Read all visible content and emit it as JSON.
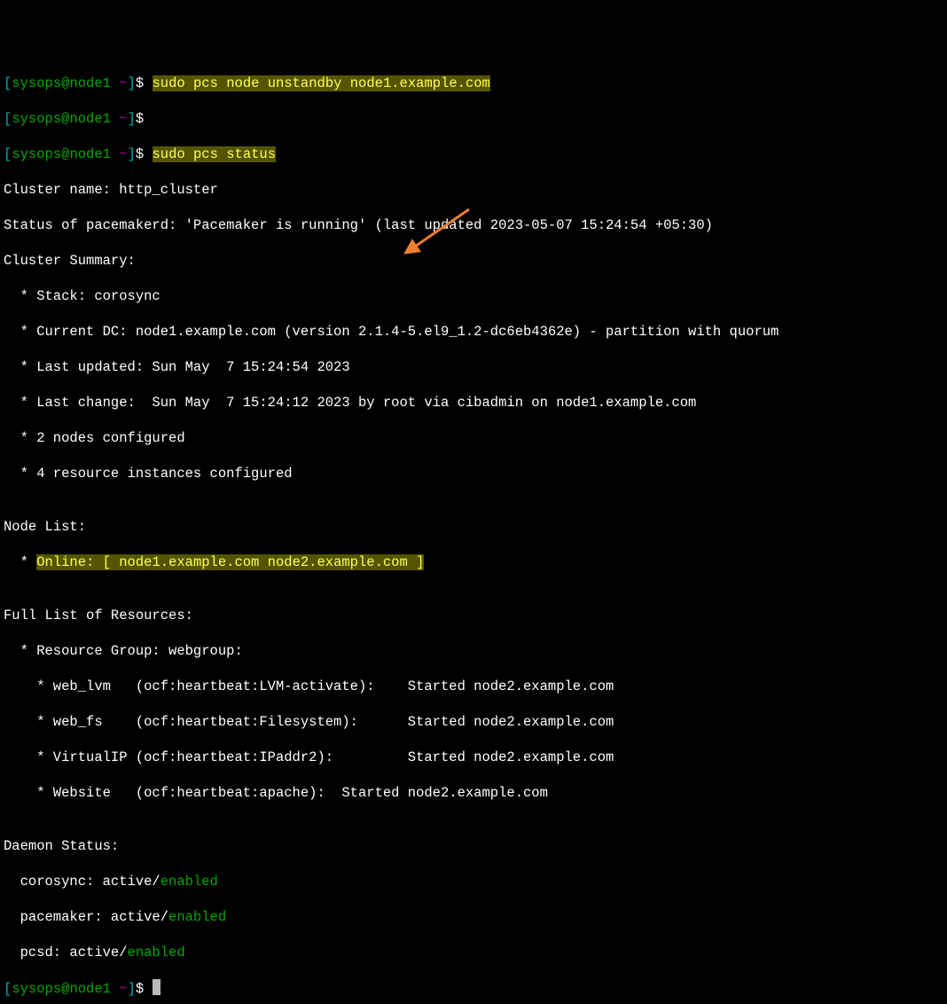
{
  "prompt": {
    "open": "[",
    "user": "sysops",
    "at": "@",
    "host": "node1",
    "space": " ",
    "tilde": "~",
    "close": "]",
    "dollar": "$ "
  },
  "commands": {
    "cmd1": "sudo pcs node unstandby node1.example.com",
    "cmd2": "sudo pcs status"
  },
  "output": {
    "clusterName": "Cluster name: http_cluster",
    "pacemakerd": "Status of pacemakerd: 'Pacemaker is running' (last updated 2023-05-07 15:24:54 +05:30)",
    "summaryHdr": "Cluster Summary:",
    "stack": "  * Stack: corosync",
    "currentDC": "  * Current DC: node1.example.com (version 2.1.4-5.el9_1.2-dc6eb4362e) - partition with quorum",
    "lastUpdated": "  * Last updated: Sun May  7 15:24:54 2023",
    "lastChange": "  * Last change:  Sun May  7 15:24:12 2023 by root via cibadmin on node1.example.com",
    "nodesCfg": "  * 2 nodes configured",
    "resCfg": "  * 4 resource instances configured",
    "blank1": "",
    "nodeListHdr": "Node List:",
    "nodeListPre": "  * ",
    "nodeListHL": "Online: [ node1.example.com node2.example.com ]",
    "blank2": "",
    "resListHdr": "Full List of Resources:",
    "resGroup": "  * Resource Group: webgroup:",
    "res1": "    * web_lvm   (ocf:heartbeat:LVM-activate):    Started node2.example.com",
    "res2": "    * web_fs    (ocf:heartbeat:Filesystem):      Started node2.example.com",
    "res3": "    * VirtualIP (ocf:heartbeat:IPaddr2):         Started node2.example.com",
    "res4": "    * Website   (ocf:heartbeat:apache):  Started node2.example.com",
    "blank3": "",
    "daemonHdr": "Daemon Status:",
    "corosync": "  corosync: active/",
    "pacemaker": "  pacemaker: active/",
    "pcsd": "  pcsd: active/",
    "enabled": "enabled"
  },
  "arrow": {
    "color": "#ed7d31",
    "name": "arrow-annotation"
  }
}
